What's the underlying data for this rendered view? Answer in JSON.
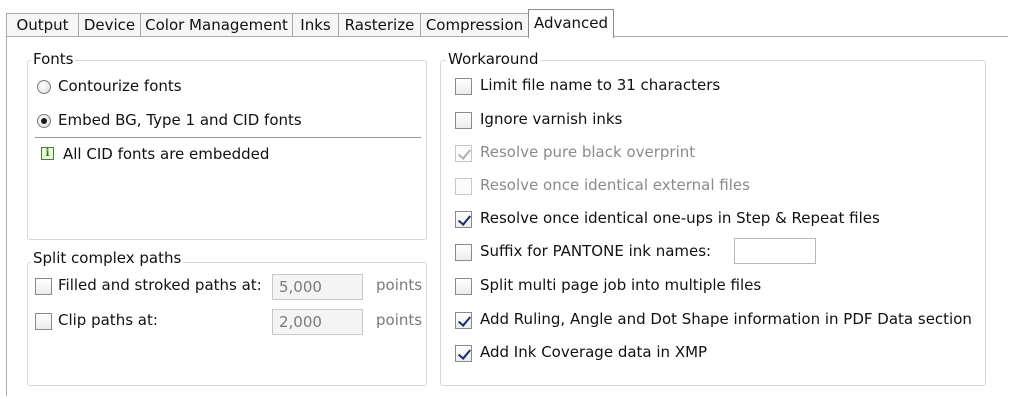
{
  "tabs": [
    "Output",
    "Device",
    "Color Management",
    "Inks",
    "Rasterize",
    "Compression",
    "Advanced"
  ],
  "active_tab": "Advanced",
  "fonts": {
    "title": "Fonts",
    "contourize_label": "Contourize fonts",
    "contourize_selected": false,
    "embed_label": "Embed BG, Type 1 and CID fonts",
    "embed_selected": true,
    "info_icon": "info-icon",
    "info_icon_glyph": "i",
    "info_text": "All CID fonts are embedded"
  },
  "split": {
    "title": "Split complex paths",
    "filled_label": "Filled and stroked paths at:",
    "filled_checked": false,
    "filled_value": "5,000",
    "filled_unit": "points",
    "clip_label": "Clip paths at:",
    "clip_checked": false,
    "clip_value": "2,000",
    "clip_unit": "points"
  },
  "workaround": {
    "title": "Workaround",
    "items": [
      {
        "label": "Limit file name to 31 characters",
        "checked": false,
        "enabled": true
      },
      {
        "label": "Ignore varnish inks",
        "checked": false,
        "enabled": true
      },
      {
        "label": "Resolve pure black overprint",
        "checked": true,
        "enabled": false
      },
      {
        "label": "Resolve once identical external files",
        "checked": false,
        "enabled": false
      },
      {
        "label": "Resolve once identical one-ups in Step & Repeat files",
        "checked": true,
        "enabled": true
      },
      {
        "label": "Suffix for PANTONE ink names:",
        "checked": false,
        "enabled": true
      },
      {
        "label": "Split multi page job into multiple files",
        "checked": false,
        "enabled": true
      },
      {
        "label": "Add Ruling, Angle and Dot Shape information in PDF Data section",
        "checked": true,
        "enabled": true
      },
      {
        "label": "Add Ink Coverage data in XMP",
        "checked": true,
        "enabled": true
      }
    ],
    "pantone_suffix_value": ""
  }
}
